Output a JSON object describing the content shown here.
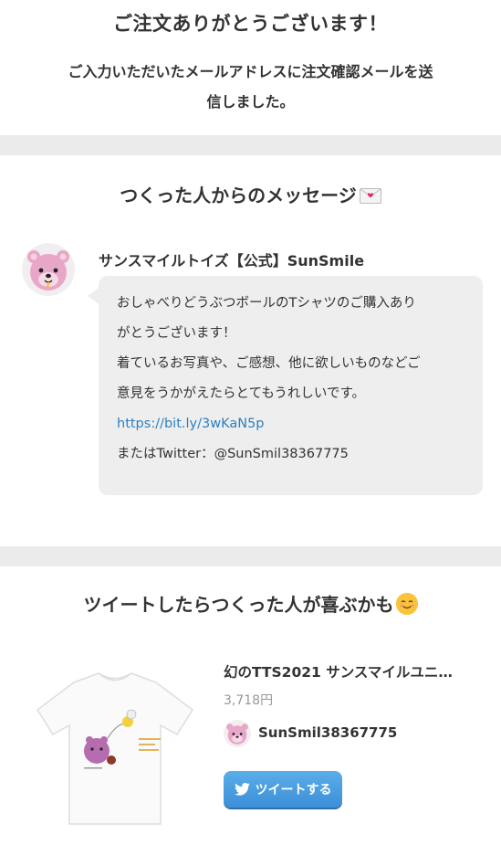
{
  "thanks": {
    "title": "ご注文ありがとうございます！",
    "line1": "ご入力いただいたメールアドレスに注文確認メールを送",
    "line2": "信しました。"
  },
  "message": {
    "heading": "つくった人からのメッセージ",
    "heading_icon": "love-letter-icon",
    "sender": "サンスマイルトイズ【公式】SunSmile",
    "lines": [
      "おしゃべりどうぶつボールのTシャツのご購入あり",
      "がとうございます！",
      "着ているお写真や、ご感想、他に欲しいものなどご",
      "意見をうかがえたらとてもうれしいです。"
    ],
    "link": "https://bit.ly/3wKaN5p",
    "twitter": "またはTwitter：@SunSmil38367775"
  },
  "tweet": {
    "heading": "ツイートしたらつくった人が喜ぶかも",
    "heading_icon": "smiling-face-icon",
    "product_title": "幻のTTS2021 サンスマイルユニ…",
    "price": "3,718円",
    "creator": "SunSmil38367775",
    "button_label": "ツイートする",
    "button_icon": "twitter-bird-icon"
  },
  "colors": {
    "divider": "#ebebeb",
    "bubble": "#eeeeee",
    "link": "#2d7fc4",
    "button": "#4a9fe0",
    "avatar_pink": "#e8a6c8"
  }
}
